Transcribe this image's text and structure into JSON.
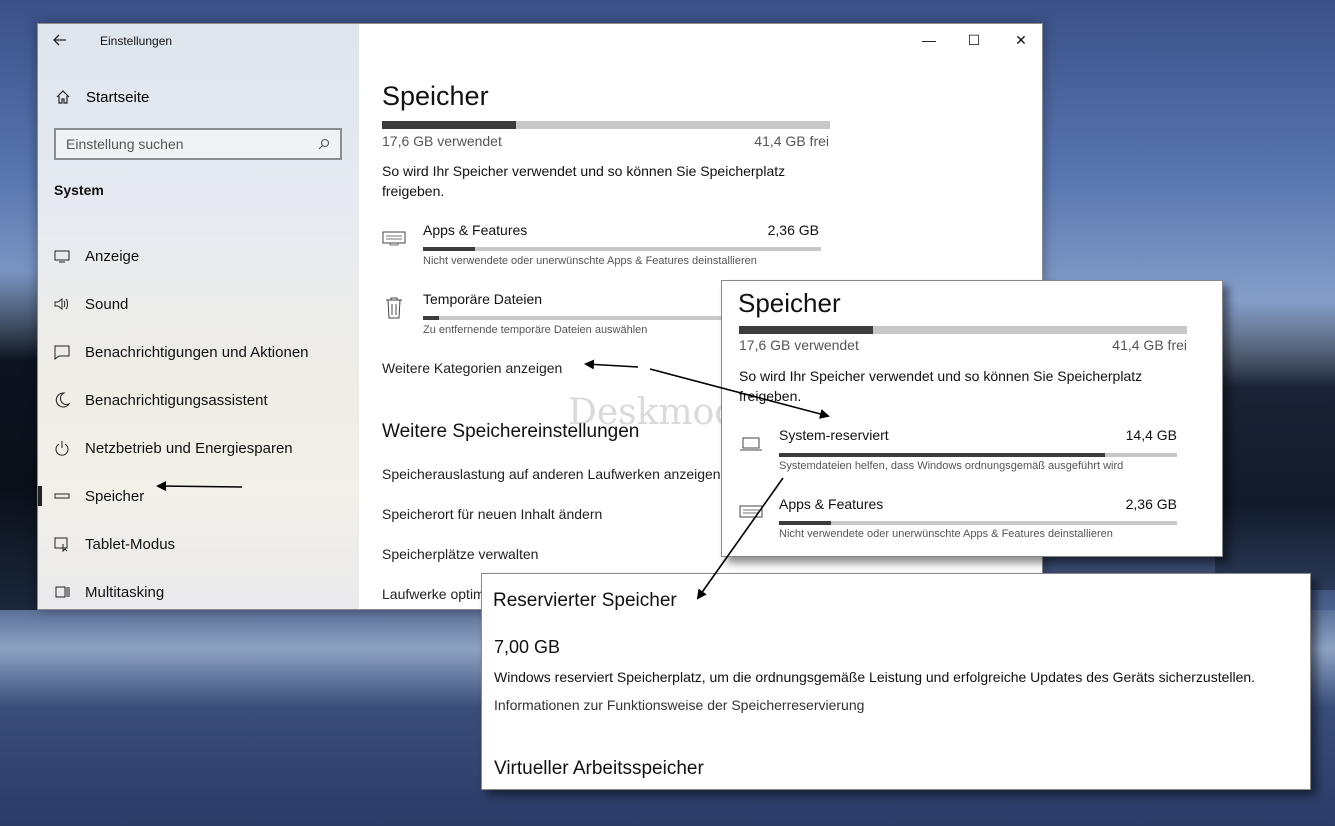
{
  "window": {
    "title": "Einstellungen",
    "controls": {
      "minimize": "—",
      "maximize": "☐",
      "close": "✕"
    }
  },
  "sidebar": {
    "home_label": "Startseite",
    "search_placeholder": "Einstellung suchen",
    "section_title": "System",
    "items": [
      {
        "label": "Anzeige",
        "icon": "monitor-icon"
      },
      {
        "label": "Sound",
        "icon": "speaker-icon"
      },
      {
        "label": "Benachrichtigungen und Aktionen",
        "icon": "message-icon"
      },
      {
        "label": "Benachrichtigungsassistent",
        "icon": "moon-icon"
      },
      {
        "label": "Netzbetrieb und Energiesparen",
        "icon": "power-icon"
      },
      {
        "label": "Speicher",
        "icon": "storage-icon",
        "active": true
      },
      {
        "label": "Tablet-Modus",
        "icon": "tablet-icon"
      },
      {
        "label": "Multitasking",
        "icon": "multitasking-icon"
      }
    ]
  },
  "main": {
    "title": "Speicher",
    "used_label": "17,6 GB verwendet",
    "free_label": "41,4 GB frei",
    "used_fraction": 0.3,
    "description": "So wird Ihr Speicher verwendet und so können Sie Speicherplatz freigeben.",
    "categories": [
      {
        "name": "Apps & Features",
        "size": "2,36 GB",
        "sub": "Nicht verwendete oder unerwünschte Apps & Features deinstallieren",
        "fraction": 0.13,
        "icon": "keyboard-icon"
      },
      {
        "name": "Temporäre Dateien",
        "size": "",
        "sub": "Zu entfernende temporäre Dateien auswählen",
        "fraction": 0.04,
        "icon": "trash-icon"
      }
    ],
    "more_categories": "Weitere Kategorien anzeigen",
    "more_settings_title": "Weitere Speichereinstellungen",
    "more_links": [
      "Speicherauslastung auf anderen Laufwerken anzeigen",
      "Speicherort für neuen Inhalt ändern",
      "Speicherplätze verwalten",
      "Laufwerke optimieren"
    ]
  },
  "overlay_storage": {
    "title": "Speicher",
    "used_label": "17,6 GB verwendet",
    "free_label": "41,4 GB frei",
    "used_fraction": 0.3,
    "description": "So wird Ihr Speicher verwendet und so können Sie Speicherplatz freigeben.",
    "categories": [
      {
        "name": "System-reserviert",
        "size": "14,4 GB",
        "sub": "Systemdateien helfen, dass Windows ordnungsgemäß ausgeführt wird",
        "fraction": 0.82,
        "icon": "laptop-icon"
      },
      {
        "name": "Apps & Features",
        "size": "2,36 GB",
        "sub": "Nicht verwendete oder unerwünschte Apps & Features deinstallieren",
        "fraction": 0.13,
        "icon": "keyboard-icon"
      }
    ]
  },
  "overlay_reserved": {
    "title": "Reservierter Speicher",
    "size": "7,00 GB",
    "description": "Windows reserviert Speicherplatz, um die ordnungsgemäße Leistung und erfolgreiche Updates des Geräts sicherzustellen.",
    "info_link": "Informationen zur Funktionsweise der Speicherreservierung",
    "virtual_title": "Virtueller Arbeitsspeicher"
  },
  "watermark": "Deskmodder.de",
  "colors": {
    "bar_fill": "#3c3c3c",
    "bar_track": "#c8c8c8",
    "accent": "#000000"
  }
}
